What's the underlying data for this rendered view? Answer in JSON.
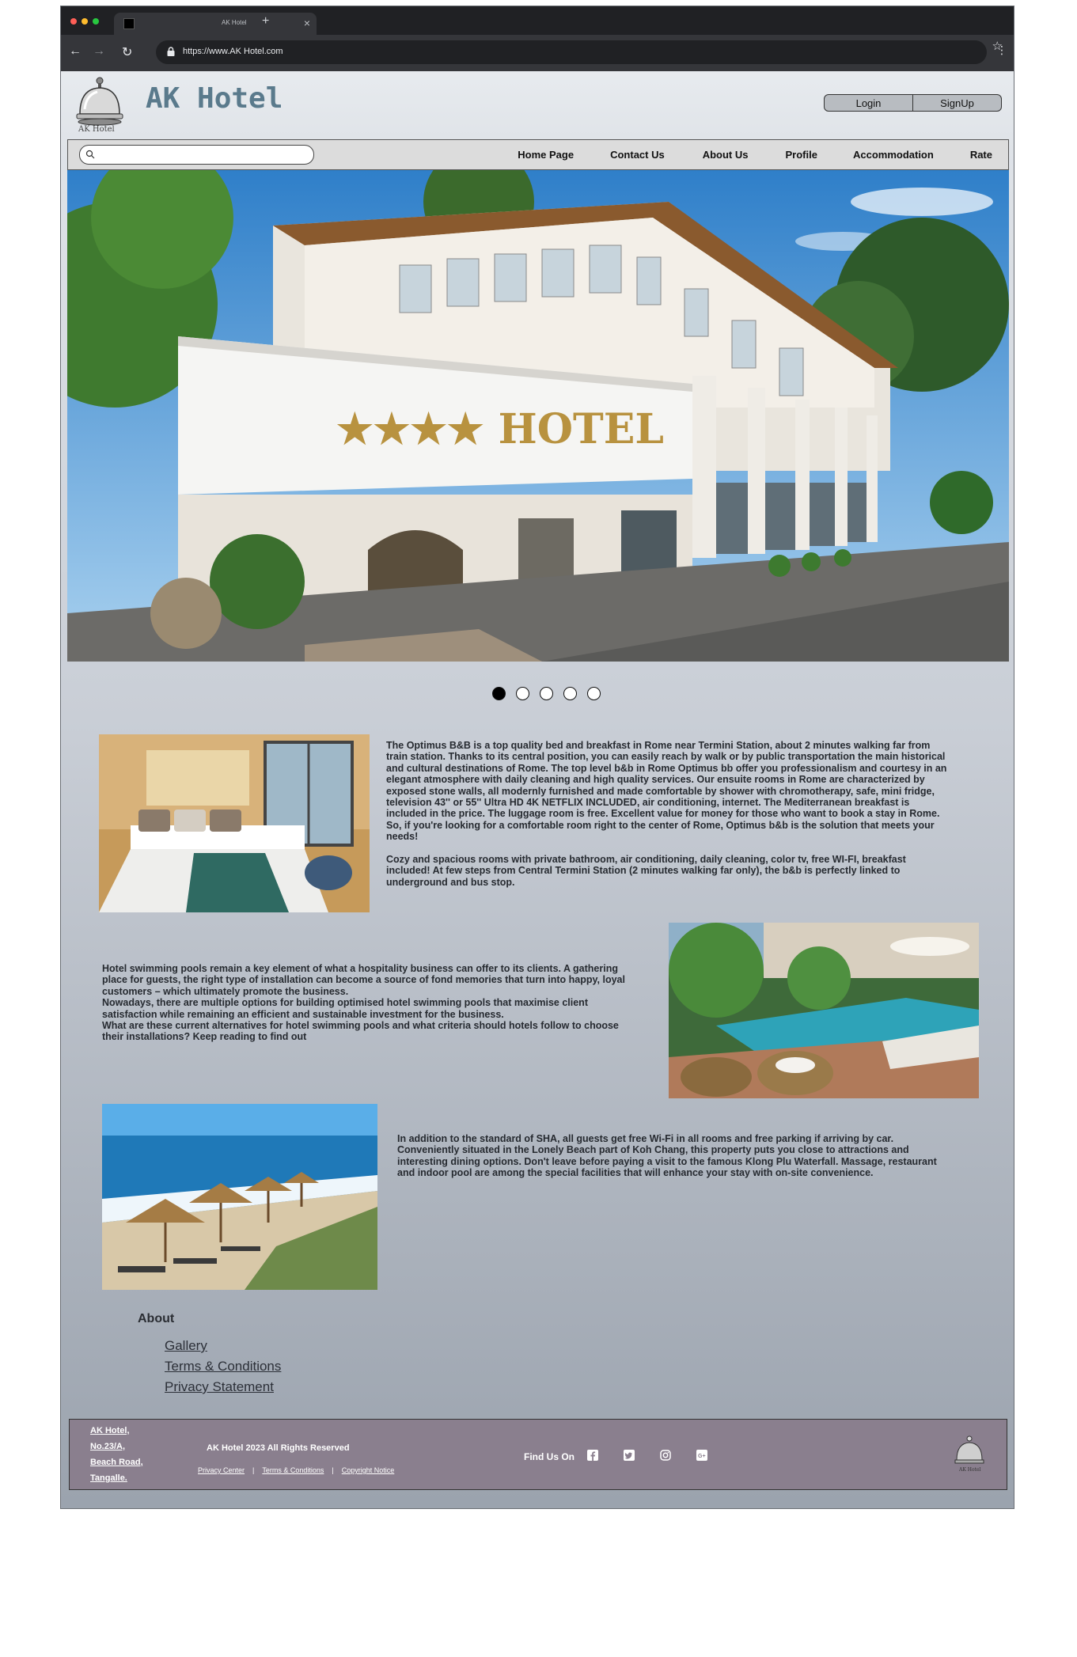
{
  "browser": {
    "tab_title": "AK Hotel",
    "url": "https://www.AK Hotel.com"
  },
  "header": {
    "logo_text": "AK Hotel",
    "brand": "AK Hotel",
    "login_label": "Login",
    "signup_label": "SignUp"
  },
  "nav": {
    "search_placeholder": "",
    "items": [
      "Home Page",
      "Contact Us",
      "About Us",
      "Profile",
      "Accommodation",
      "Rate"
    ]
  },
  "carousel": {
    "count": 5,
    "active_index": 0
  },
  "sections": {
    "rooms_text": "The Optimus B&B is a top quality bed and breakfast in Rome near Termini Station, about 2 minutes walking far from\ntrain station. Thanks to its central position, you can easily reach by walk or by public transportation the main historical\nand cultural destinations of Rome. The top level b&b in Rome Optimus bb offer you professionalism and courtesy in an\nelegant atmosphere with daily cleaning and high quality services. Our ensuite rooms in Rome are characterized by\nexposed stone walls, all modernly furnished and made comfortable by shower with chromotherapy, safe, mini fridge,\ntelevision 43'' or 55'' Ultra HD 4K NETFLIX INCLUDED, air conditioning, internet. The Mediterranean breakfast is\nincluded in the price. The luggage room is free. Excellent value for money for those who want to book a stay in Rome.\nSo, if you're looking for a comfortable room right to the center of Rome, Optimus b&b is the solution that meets your\nneeds!\n\nCozy and spacious rooms with private bathroom, air conditioning, daily cleaning, color tv, free WI-FI, breakfast\nincluded! At few steps from Central Termini Station (2 minutes walking far only), the b&b is perfectly linked to\nunderground and bus stop.",
    "pool_text": "Hotel swimming pools remain a key element of what a hospitality business can offer to its clients. A gathering\nplace for guests, the right type of installation can become a source of fond memories that turn into happy, loyal\ncustomers – which ultimately promote the business.\nNowadays, there are multiple options for building optimised hotel swimming pools that maximise client\nsatisfaction while remaining an efficient and sustainable investment for the business.\nWhat are these current alternatives for hotel swimming pools and what criteria should hotels follow to choose\ntheir installations? Keep reading to find out",
    "beach_text": "In addition to the standard of SHA, all guests get free Wi-Fi in all rooms and free parking if arriving by car.\nConveniently situated in the Lonely Beach part of Koh Chang, this property puts you close to attractions and\ninteresting dining options. Don't leave before paying a visit to the famous Klong Plu Waterfall. Massage, restaurant\nand indoor pool are among the special facilities that will enhance your stay with on-site convenience."
  },
  "about": {
    "heading": "About",
    "links": [
      "Gallery",
      "Terms & Conditions",
      "Privacy Statement"
    ]
  },
  "footer": {
    "address": [
      "AK Hotel,",
      "No.23/A,",
      "Beach Road,",
      "Tangalle."
    ],
    "copyright": "AK Hotel 2023 All Rights Reserved",
    "links": [
      "Privacy Center",
      "Terms & Conditions",
      "Copyright Notice"
    ],
    "find_us": "Find Us On",
    "social_icons": [
      "facebook-icon",
      "twitter-icon",
      "instagram-icon",
      "google-plus-icon"
    ],
    "logo_text": "AK Hotel"
  },
  "colors": {
    "brand": "#5a7a8c",
    "footer_bg": "#8a7f8e",
    "chrome": "#202124"
  }
}
